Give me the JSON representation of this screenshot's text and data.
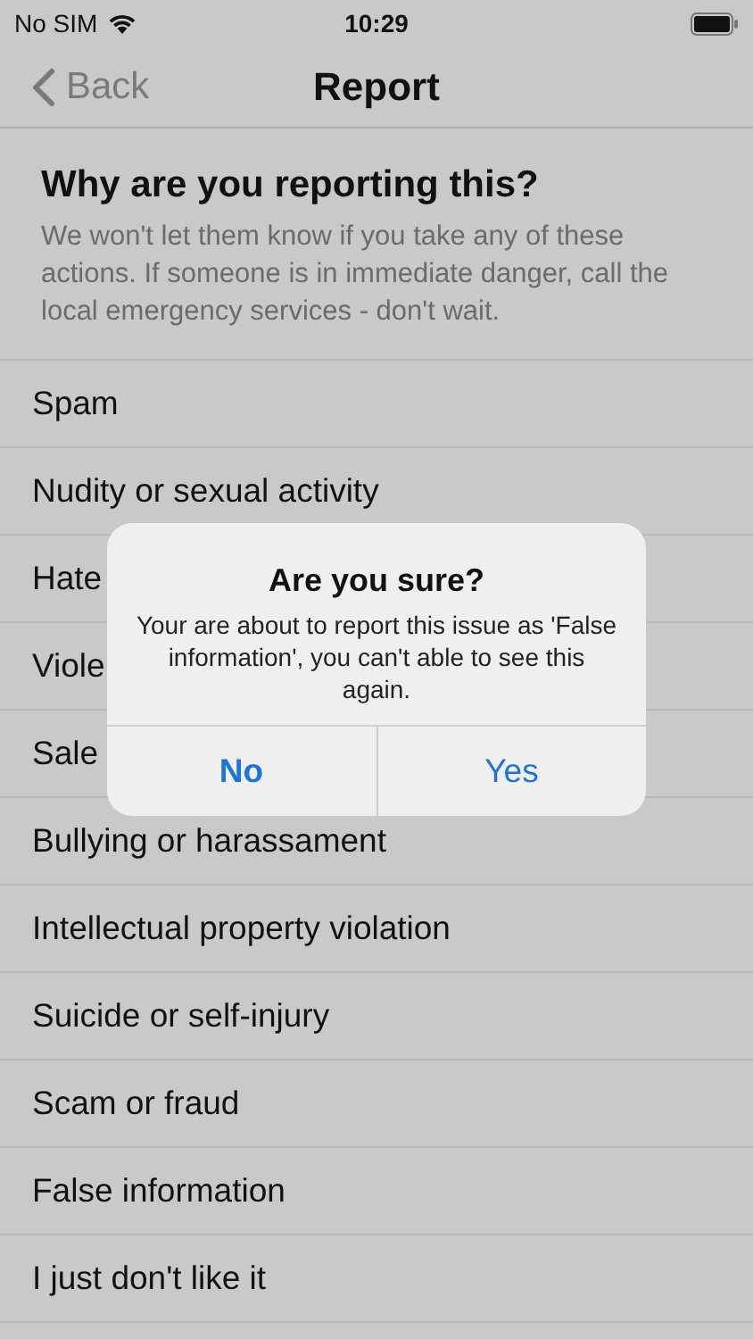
{
  "status_bar": {
    "carrier": "No SIM",
    "time": "10:29"
  },
  "nav": {
    "back": "Back",
    "title": "Report"
  },
  "header": {
    "title": "Why are you reporting this?",
    "text": "We won't let them know if you take any of these actions. If someone is in immediate danger, call the local emergency services - don't wait."
  },
  "reasons": [
    "Spam",
    "Nudity or sexual activity",
    "Hate",
    "Viole",
    "Sale",
    "Bullying or harassament",
    "Intellectual property violation",
    "Suicide or self-injury",
    "Scam or fraud",
    "False information",
    "I just don't like it"
  ],
  "alert": {
    "title": "Are you sure?",
    "message": "Your are about to report this issue as 'False information', you can't able to see this again.",
    "buttons": [
      {
        "label": "No",
        "preferred": true
      },
      {
        "label": "Yes",
        "preferred": false
      }
    ]
  }
}
